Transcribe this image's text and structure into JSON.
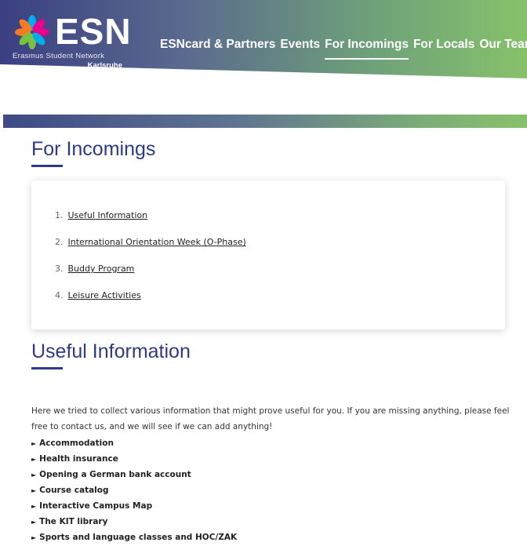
{
  "header": {
    "logo": {
      "word": "ESN",
      "subtitle": "Erasmus Student Network",
      "city": "Karlsruhe"
    },
    "nav": [
      {
        "label": "ESNcard & Partners",
        "active": false
      },
      {
        "label": "Events",
        "active": false
      },
      {
        "label": "For Incomings",
        "active": true
      },
      {
        "label": "For Locals",
        "active": false
      },
      {
        "label": "Our Team",
        "active": false
      }
    ]
  },
  "page": {
    "title": "For Incomings",
    "toc": [
      {
        "num": "1.",
        "label": "Useful Information"
      },
      {
        "num": "2.",
        "label": "International Orientation Week (O-Phase)"
      },
      {
        "num": "3.",
        "label": "Buddy Program"
      },
      {
        "num": "4.",
        "label": "Leisure Activities"
      }
    ]
  },
  "section": {
    "title": "Useful Information",
    "intro": "Here we tried to collect various information that might prove useful for you. If you are missing anything, please feel free to contact us, and we will see if we can add anything!",
    "items": [
      "Accommodation",
      "Health insurance",
      "Opening a German bank account",
      "Course catalog",
      "Interactive Campus Map",
      "The KIT library",
      "Sports and language classes and HOC/ZAK"
    ],
    "arrow_glyph": "►"
  },
  "colors": {
    "title_blue": "#2e3a87",
    "gradient_start": "#3a3f82",
    "gradient_end": "#88c16b",
    "star_cyan": "#00aeef",
    "star_magenta": "#ec008c",
    "star_green": "#7ac143",
    "star_orange": "#f47b20"
  }
}
